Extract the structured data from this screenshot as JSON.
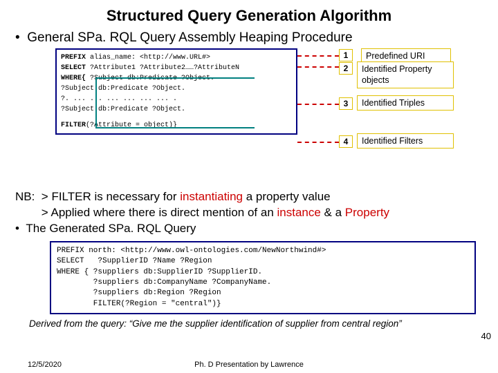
{
  "title": "Structured Query Generation Algorithm",
  "bullet": "General SPa. RQL Query Assembly Heaping Procedure",
  "code1": {
    "l1a": "PREFIX ",
    "l1b": "alias_name: <http://www.URL#>",
    "l2a": "SELECT  ",
    "l2b": "?Attribute1 ?Attribute2……?AttributeN",
    "l3a": "WHERE{ ",
    "l3b": "?Subject db:Predicate ?Object.",
    "l4": "       ?Subject db:Predicate ?Object.",
    "l5": "       ?. ... ... ... ... ... ... .",
    "l6": "       ?Subject db:Predicate ?Object.",
    "l7a": "       FILTER",
    "l7b": "(?Attribute = object)}"
  },
  "nums": {
    "n1": "1",
    "n2": "2",
    "n3": "3",
    "n4": "4"
  },
  "labels": {
    "l1": "Predefined URI",
    "l2": "Identified Property objects",
    "l3": "Identified Triples",
    "l4": "Identified Filters"
  },
  "nb": {
    "prefix": "NB:",
    "line1a": "> FILTER is necessary  for ",
    "line1b": "instantiating",
    "line1c": " a property value",
    "line2a": "> Applied where there is ",
    "line2b": "direct mention",
    "line2c": " of an ",
    "line2d": "instance",
    "line2e": " & a ",
    "line2f": "Property"
  },
  "bullet2": "The Generated SPa. RQL Query",
  "code2": "PREFIX north: <http://www.owl-ontologies.com/NewNorthwind#>\nSELECT   ?SupplierID ?Name ?Region\nWHERE { ?suppliers db:SupplierID ?SupplierID.\n        ?suppliers db:CompanyName ?CompanyName.\n        ?suppliers db:Region ?Region\n        FILTER(?Region = \"central\")}",
  "derived": "Derived from the query: “Give me the supplier identification of supplier from central region”",
  "pagenum": "40",
  "footer": {
    "date": "12/5/2020",
    "mid": "Ph. D Presentation by Lawrence"
  }
}
